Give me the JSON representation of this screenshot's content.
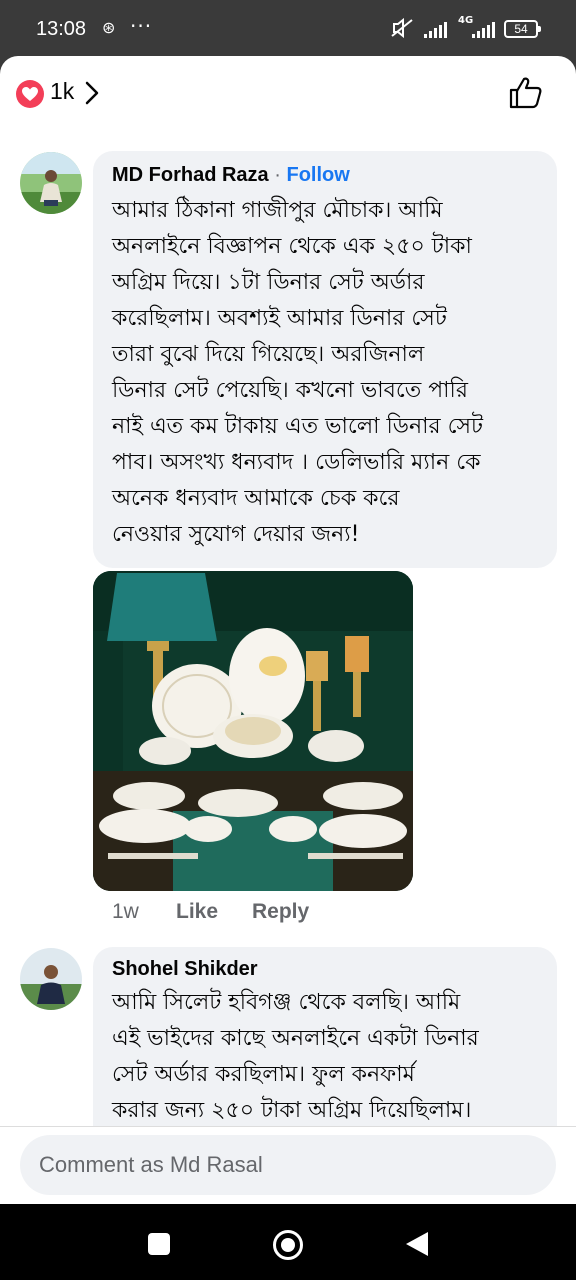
{
  "status_bar": {
    "time": "13:08",
    "battery": "54",
    "network": "4G"
  },
  "header": {
    "reaction_count": "1k",
    "colors": {
      "heart": "#f33e58"
    }
  },
  "comments": [
    {
      "author": "MD Forhad Raza",
      "separator": "·",
      "follow_label": "Follow",
      "text": "আমার ঠিকানা গাজীপুর মৌচাক। আমি\nঅনলাইনে বিজ্ঞাপন থেকে এক ২৫০ টাকা\nঅগ্রিম দিয়ে। ১টা ডিনার সেট  অর্ডার\nকরেছিলাম। অবশ্যই আমার  ডিনার সেট\nতারা বুঝে দিয়ে গিয়েছে। অরজিনাল\nডিনার সেট  পেয়েছি। কখনো ভাবতে পারি\nনাই এত কম টাকায় এত ভালো ডিনার সেট\nপাব। অসংখ্য ধন্যবাদ । ডেলিভারি ম্যান কে\nঅনেক ধন্যবাদ আমাকে চেক করে\nনেওয়ার সুযোগ দেয়ার জন্য!",
      "time": "1w",
      "like_label": "Like",
      "reply_label": "Reply"
    },
    {
      "author": "Shohel Shikder",
      "text": "আমি সিলেট হবিগঞ্জ থেকে বলছি। আমি\nএই ভাইদের কাছে অনলাইনে একটা ডিনার\nসেট  অর্ডার করছিলাম। ফুল কনফার্ম\nকরার জন্য ২৫০ টাকা অগ্রিম দিয়েছিলাম।"
    }
  ],
  "composer": {
    "placeholder": "Comment as Md Rasal"
  },
  "colors": {
    "link": "#1877f2",
    "bubble": "#f0f2f5",
    "secondary_text": "#65676b"
  }
}
